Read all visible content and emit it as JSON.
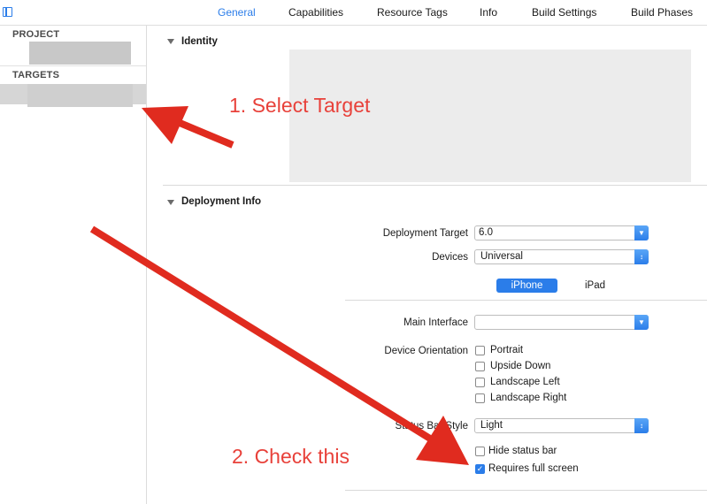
{
  "tabs": {
    "general": "General",
    "capabilities": "Capabilities",
    "resource_tags": "Resource Tags",
    "info": "Info",
    "build_settings": "Build Settings",
    "build_phases": "Build Phases"
  },
  "sidebar": {
    "project_heading": "PROJECT",
    "targets_heading": "TARGETS"
  },
  "identity": {
    "title": "Identity"
  },
  "deployment": {
    "title": "Deployment Info",
    "deployment_target_label": "Deployment Target",
    "deployment_target_value": "6.0",
    "devices_label": "Devices",
    "devices_value": "Universal",
    "segments": {
      "iphone": "iPhone",
      "ipad": "iPad"
    },
    "main_interface_label": "Main Interface",
    "main_interface_value": "",
    "device_orientation_label": "Device Orientation",
    "orientations": [
      "Portrait",
      "Upside Down",
      "Landscape Left",
      "Landscape Right"
    ],
    "status_bar_style_label": "Status Bar Style",
    "status_bar_style_value": "Light",
    "hide_status_bar_label": "Hide status bar",
    "requires_full_screen_label": "Requires full screen",
    "requires_full_screen_checked": true,
    "hide_status_bar_checked": false
  },
  "annotations": {
    "step1": "1. Select Target",
    "step2": "2. Check this"
  },
  "colors": {
    "accent": "#2b7de9",
    "annotation": "#e8413a"
  }
}
